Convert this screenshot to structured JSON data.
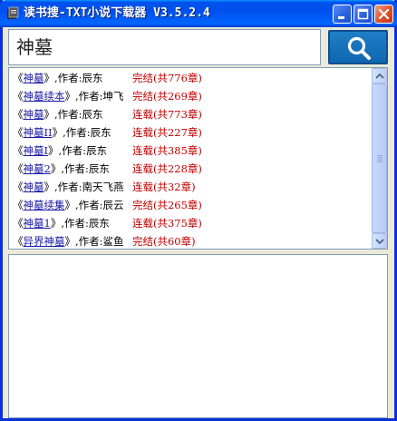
{
  "window": {
    "title": "读书搜-TXT小说下载器 V3.5.2.4"
  },
  "search": {
    "query": "神墓",
    "icon": "magnifier-icon"
  },
  "results": [
    {
      "title": "神墓",
      "author": "辰东",
      "status": "完结(共776章)"
    },
    {
      "title": "神墓续本",
      "author": "坤飞",
      "status": "完结(共269章)"
    },
    {
      "title": "神墓",
      "author": "辰东",
      "status": "连载(共773章)"
    },
    {
      "title": "神墓II",
      "author": "辰东",
      "status": "连载(共227章)"
    },
    {
      "title": "神墓Ⅰ",
      "author": "辰东",
      "status": "连载(共385章)"
    },
    {
      "title": "神墓2",
      "author": "辰东",
      "status": "连载(共228章)"
    },
    {
      "title": "神墓",
      "author": "南天飞燕",
      "status": "连载(共32章)"
    },
    {
      "title": "神墓续集",
      "author": "辰云",
      "status": "完结(共265章)"
    },
    {
      "title": "神墓1",
      "author": "辰东",
      "status": "连载(共375章)"
    },
    {
      "title": "异界神墓",
      "author": "鲨鱼",
      "status": "完结(共60章)"
    }
  ],
  "labels": {
    "open_bracket": "《",
    "close_bracket": "》",
    "author_prefix": ",作者:"
  },
  "colors": {
    "titlebar": "#0054e3",
    "link": "#1a1aa6",
    "status": "#c00000",
    "search_button": "#1066b0"
  }
}
